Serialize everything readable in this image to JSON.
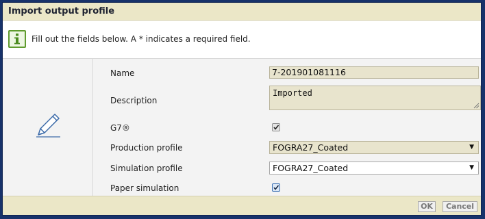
{
  "dialog": {
    "title": "Import output profile"
  },
  "info": {
    "icon": "info-icon",
    "message": "Fill out the fields below. A * indicates a required field."
  },
  "form": {
    "icon": "pencil-icon",
    "name": {
      "label": "Name",
      "value": "7-201901081116"
    },
    "description": {
      "label": "Description",
      "value": "Imported"
    },
    "g7": {
      "label": "G7®",
      "checked": true
    },
    "production_profile": {
      "label": "Production profile",
      "value": "FOGRA27_Coated"
    },
    "simulation_profile": {
      "label": "Simulation profile",
      "value": "FOGRA27_Coated"
    },
    "paper_simulation": {
      "label": "Paper simulation",
      "checked": true
    }
  },
  "buttons": {
    "ok": "OK",
    "cancel": "Cancel"
  },
  "colors": {
    "titlebar": "#ebe7c7",
    "field_bg": "#e8e4cd",
    "info_green": "#5f9b2e",
    "frame": "#17326a"
  }
}
